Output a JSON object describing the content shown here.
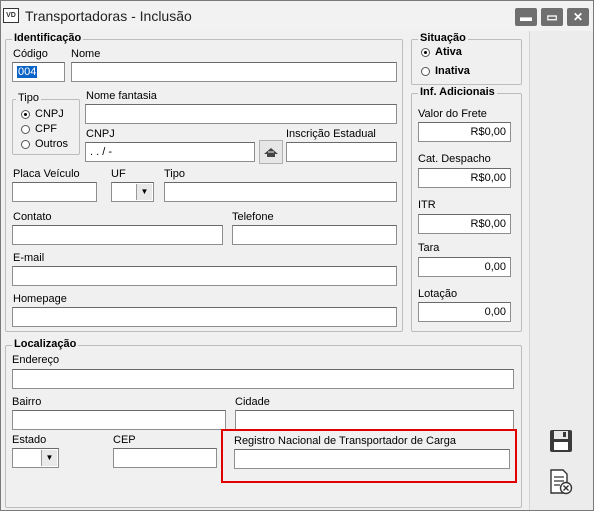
{
  "window": {
    "icon_text": "VD",
    "title": "Transportadoras - Inclusão",
    "minimize_glyph": "▬",
    "maximize_glyph": "▭",
    "close_glyph": "✕"
  },
  "identificacao": {
    "legend": "Identificação",
    "codigo_label": "Código",
    "codigo_value": "004",
    "nome_label": "Nome",
    "nome_value": "",
    "tipo": {
      "legend": "Tipo",
      "options": [
        "CNPJ",
        "CPF",
        "Outros"
      ],
      "selected": "CNPJ"
    },
    "nome_fantasia_label": "Nome fantasia",
    "cnpj_label": "CNPJ",
    "cnpj_mask": " .  .  /   -",
    "inscricao_label": "Inscrição Estadual",
    "placa_label": "Placa Veículo",
    "uf_label": "UF",
    "tipo_label": "Tipo",
    "contato_label": "Contato",
    "telefone_label": "Telefone",
    "email_label": "E-mail",
    "homepage_label": "Homepage"
  },
  "situacao": {
    "legend": "Situação",
    "options": [
      "Ativa",
      "Inativa"
    ],
    "selected": "Ativa"
  },
  "inf_adicionais": {
    "legend": "Inf. Adicionais",
    "valor_frete_label": "Valor do Frete",
    "valor_frete_value": "R$0,00",
    "cat_despacho_label": "Cat. Despacho",
    "cat_despacho_value": "R$0,00",
    "itr_label": "ITR",
    "itr_value": "R$0,00",
    "tara_label": "Tara",
    "tara_value": "0,00",
    "lotacao_label": "Lotação",
    "lotacao_value": "0,00"
  },
  "localizacao": {
    "legend": "Localização",
    "endereco_label": "Endereço",
    "bairro_label": "Bairro",
    "cidade_label": "Cidade",
    "estado_label": "Estado",
    "cep_label": "CEP",
    "rntrc_label": "Registro Nacional de Transportador de Carga"
  },
  "icons": {
    "save": "save-icon",
    "cancel": "cancel-document-icon",
    "search": "search-icon",
    "dropdown": "chevron-down-icon"
  },
  "colors": {
    "highlight": "#e30000",
    "selection": "#0a64c8"
  }
}
